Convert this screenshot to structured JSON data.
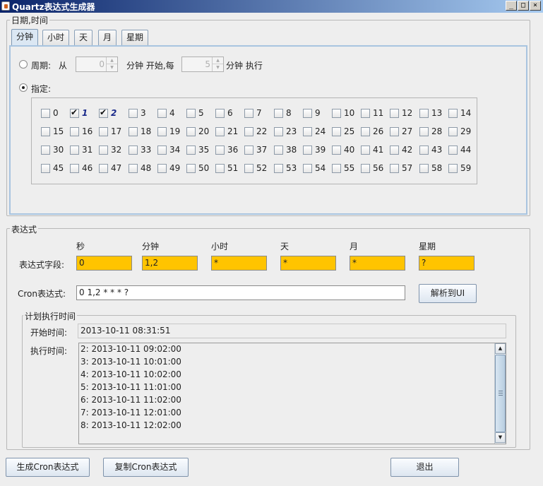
{
  "window": {
    "title": "Quartz表达式生成器",
    "minimize": "_",
    "maximize": "□",
    "close": "×"
  },
  "datetime_group": {
    "label": "日期,时间",
    "tabs": [
      {
        "label": "分钟",
        "active": true
      },
      {
        "label": "小时",
        "active": false
      },
      {
        "label": "天",
        "active": false
      },
      {
        "label": "月",
        "active": false
      },
      {
        "label": "星期",
        "active": false
      }
    ],
    "period": {
      "radio_label": "周期:",
      "from_label": "从",
      "start_value": "0",
      "start_suffix": "分钟 开始,每",
      "every_value": "5",
      "every_suffix": "分钟 执行"
    },
    "specify": {
      "radio_label": "指定:"
    },
    "minutes": [
      {
        "label": "0",
        "checked": false
      },
      {
        "label": "1",
        "checked": true
      },
      {
        "label": "2",
        "checked": true
      },
      {
        "label": "3",
        "checked": false
      },
      {
        "label": "4",
        "checked": false
      },
      {
        "label": "5",
        "checked": false
      },
      {
        "label": "6",
        "checked": false
      },
      {
        "label": "7",
        "checked": false
      },
      {
        "label": "8",
        "checked": false
      },
      {
        "label": "9",
        "checked": false
      },
      {
        "label": "10",
        "checked": false
      },
      {
        "label": "11",
        "checked": false
      },
      {
        "label": "12",
        "checked": false
      },
      {
        "label": "13",
        "checked": false
      },
      {
        "label": "14",
        "checked": false
      },
      {
        "label": "15",
        "checked": false
      },
      {
        "label": "16",
        "checked": false
      },
      {
        "label": "17",
        "checked": false
      },
      {
        "label": "18",
        "checked": false
      },
      {
        "label": "19",
        "checked": false
      },
      {
        "label": "20",
        "checked": false
      },
      {
        "label": "21",
        "checked": false
      },
      {
        "label": "22",
        "checked": false
      },
      {
        "label": "23",
        "checked": false
      },
      {
        "label": "24",
        "checked": false
      },
      {
        "label": "25",
        "checked": false
      },
      {
        "label": "26",
        "checked": false
      },
      {
        "label": "27",
        "checked": false
      },
      {
        "label": "28",
        "checked": false
      },
      {
        "label": "29",
        "checked": false
      },
      {
        "label": "30",
        "checked": false
      },
      {
        "label": "31",
        "checked": false
      },
      {
        "label": "32",
        "checked": false
      },
      {
        "label": "33",
        "checked": false
      },
      {
        "label": "34",
        "checked": false
      },
      {
        "label": "35",
        "checked": false
      },
      {
        "label": "36",
        "checked": false
      },
      {
        "label": "37",
        "checked": false
      },
      {
        "label": "38",
        "checked": false
      },
      {
        "label": "39",
        "checked": false
      },
      {
        "label": "40",
        "checked": false
      },
      {
        "label": "41",
        "checked": false
      },
      {
        "label": "42",
        "checked": false
      },
      {
        "label": "43",
        "checked": false
      },
      {
        "label": "44",
        "checked": false
      },
      {
        "label": "45",
        "checked": false
      },
      {
        "label": "46",
        "checked": false
      },
      {
        "label": "47",
        "checked": false
      },
      {
        "label": "48",
        "checked": false
      },
      {
        "label": "49",
        "checked": false
      },
      {
        "label": "50",
        "checked": false
      },
      {
        "label": "51",
        "checked": false
      },
      {
        "label": "52",
        "checked": false
      },
      {
        "label": "53",
        "checked": false
      },
      {
        "label": "54",
        "checked": false
      },
      {
        "label": "55",
        "checked": false
      },
      {
        "label": "56",
        "checked": false
      },
      {
        "label": "57",
        "checked": false
      },
      {
        "label": "58",
        "checked": false
      },
      {
        "label": "59",
        "checked": false
      }
    ]
  },
  "expression_group": {
    "label": "表达式",
    "field_row_label": "表达式字段:",
    "columns": [
      "秒",
      "分钟",
      "小时",
      "天",
      "月",
      "星期"
    ],
    "values": [
      "0",
      "1,2",
      "*",
      "*",
      "*",
      "?"
    ],
    "cron_label": "Cron表达式:",
    "cron_value": "0 1,2 * * * ?",
    "parse_button": "解析到UI",
    "field_color": "#ffc400"
  },
  "schedule_group": {
    "label": "计划执行时间",
    "start_label": "开始时间:",
    "start_value": "2013-10-11 08:31:51",
    "exec_label": "执行时间:",
    "exec_times": [
      "2: 2013-10-11 09:02:00",
      "3: 2013-10-11 10:01:00",
      "4: 2013-10-11 10:02:00",
      "5: 2013-10-11 11:01:00",
      "6: 2013-10-11 11:02:00",
      "7: 2013-10-11 12:01:00",
      "8: 2013-10-11 12:02:00"
    ]
  },
  "footer": {
    "generate_button": "生成Cron表达式",
    "copy_button": "复制Cron表达式",
    "exit_button": "退出"
  }
}
